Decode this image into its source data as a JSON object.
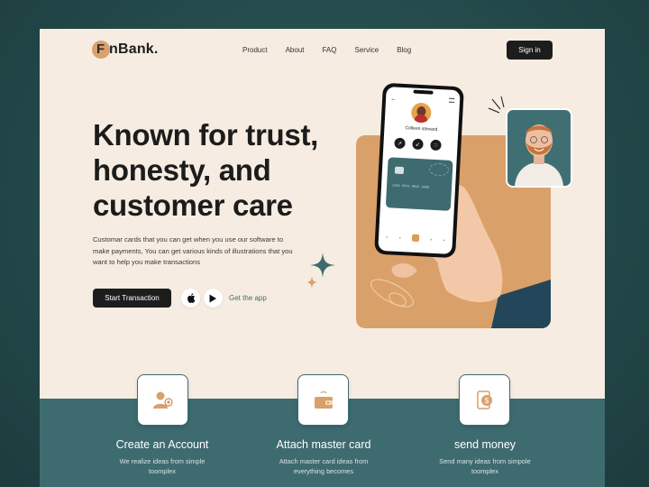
{
  "brand": {
    "logo_letter": "F",
    "logo_text": "nBank."
  },
  "nav": {
    "items": [
      "Product",
      "About",
      "FAQ",
      "Service",
      "Blog"
    ],
    "signin_label": "Sign in"
  },
  "hero": {
    "title_lines": [
      "Known for trust,",
      "honesty, and",
      "customer care"
    ],
    "description": "Customar cards that you can get when you use our software to make payments, You can get various kinds of illustrations that you want to help you make transactions",
    "cta_label": "Start Transaction",
    "get_app_label": "Get the app"
  },
  "phone": {
    "profile_name": "Colleen steward",
    "card_number": "1234 5678 9012 3456"
  },
  "features": [
    {
      "title": "Create an Account",
      "desc": "We realize ideas from simple toomplex"
    },
    {
      "title": "Attach master card",
      "desc": "Attach master card ideas from everything becomes"
    },
    {
      "title": "send money",
      "desc": "Send many ideas from simpole toomplex"
    }
  ],
  "colors": {
    "background": "#234849",
    "frame": "#f6ece1",
    "accent": "#d9a06a",
    "teal": "#3d6b70",
    "dark": "#1d1d1d"
  },
  "icons": {
    "apple": "apple-icon",
    "play": "google-play-icon",
    "account": "user-add-icon",
    "card": "wallet-card-icon",
    "send": "send-money-icon"
  }
}
